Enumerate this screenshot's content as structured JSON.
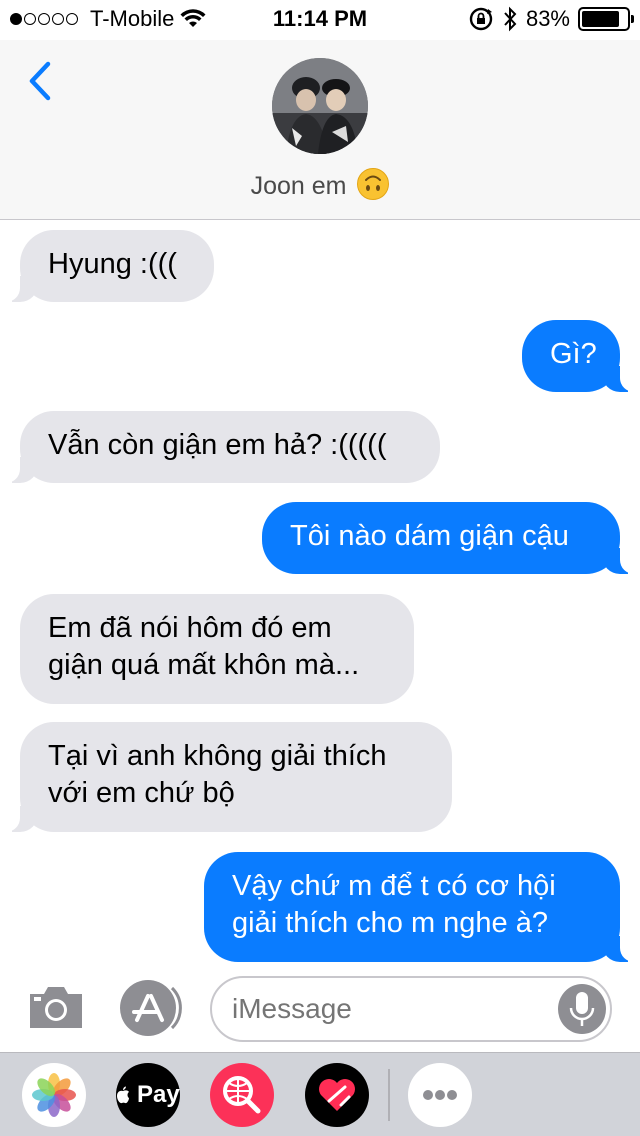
{
  "status_bar": {
    "signal_dots_filled": 1,
    "signal_dots_total": 5,
    "carrier": "T-Mobile",
    "time": "11:14 PM",
    "battery_percent": "83%",
    "battery_level": 0.83,
    "icons": [
      "wifi-icon",
      "rotation-lock-icon",
      "bluetooth-icon",
      "battery-icon"
    ]
  },
  "header": {
    "back_icon": "chevron-left-icon",
    "contact_name": "Joon em",
    "contact_emoji": "upside-down-face-emoji"
  },
  "messages": [
    {
      "direction": "incoming",
      "text": "Hyung :((("
    },
    {
      "direction": "outgoing",
      "text": "Gì?"
    },
    {
      "direction": "incoming",
      "text": "Vẫn còn giận em hả? :((((("
    },
    {
      "direction": "outgoing",
      "text": "Tôi nào dám giận cậu"
    },
    {
      "direction": "incoming",
      "text": "Em đã nói hôm đó em\ngiận quá mất khôn mà..."
    },
    {
      "direction": "incoming",
      "text": "Tại vì anh không giải thích\nvới em chứ bộ"
    },
    {
      "direction": "outgoing",
      "text": "Vậy chứ m để t có cơ hội\ngiải thích cho m nghe à?"
    }
  ],
  "input_bar": {
    "placeholder": "iMessage",
    "camera_icon": "camera-icon",
    "appstore_icon": "app-store-icon",
    "mic_icon": "microphone-icon"
  },
  "app_drawer": {
    "apps": [
      "photos-app-icon",
      "apple-pay-app-icon",
      "web-search-app-icon",
      "digital-touch-app-icon",
      "more-apps-icon"
    ],
    "apple_pay_label": "Pay"
  },
  "colors": {
    "outgoing_bubble": "#0a7cff",
    "incoming_bubble": "#e5e5ea",
    "accent": "#0a7cff"
  }
}
